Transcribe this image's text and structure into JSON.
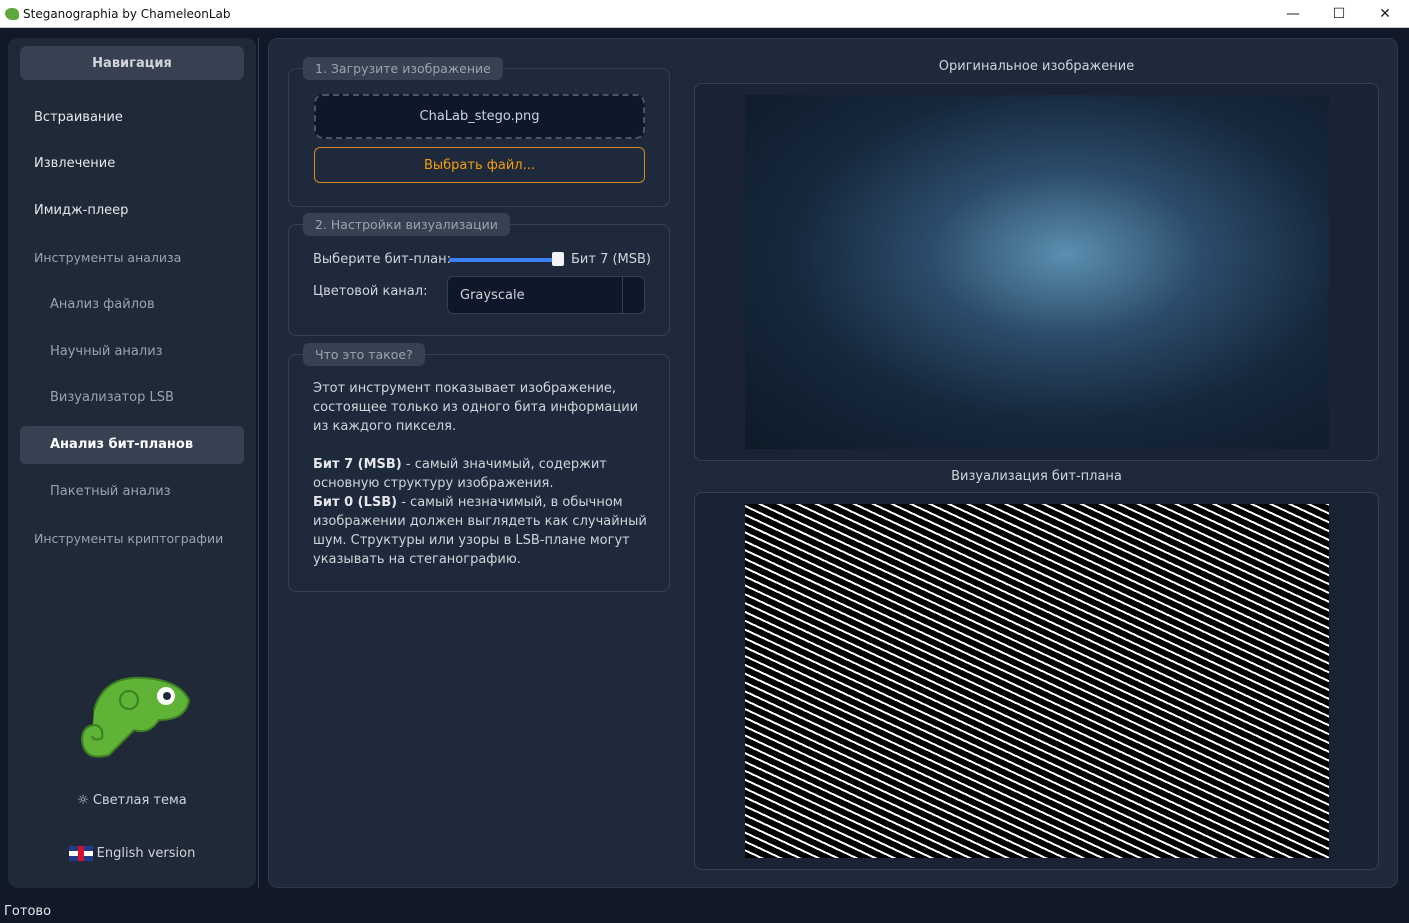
{
  "window": {
    "title": "Steganographia by ChameleonLab",
    "minimize": "—",
    "maximize": "☐",
    "close": "✕"
  },
  "sidebar": {
    "header": "Навигация",
    "items": [
      {
        "label": "Встраивание",
        "type": "top"
      },
      {
        "label": "Извлечение",
        "type": "top"
      },
      {
        "label": "Имидж-плеер",
        "type": "top"
      },
      {
        "label": "Инструменты анализа",
        "type": "cat"
      },
      {
        "label": "Анализ файлов",
        "type": "sub"
      },
      {
        "label": "Научный анализ",
        "type": "sub"
      },
      {
        "label": "Визуализатор LSB",
        "type": "sub"
      },
      {
        "label": "Анализ бит-планов",
        "type": "sub",
        "active": true
      },
      {
        "label": "Пакетный анализ",
        "type": "sub"
      },
      {
        "label": "Инструменты криптографии",
        "type": "cat"
      }
    ],
    "theme_toggle": "Светлая тема",
    "language": "English version"
  },
  "load": {
    "title": "1. Загрузите изображение",
    "filename": "ChaLab_stego.png",
    "choose_button": "Выбрать файл..."
  },
  "settings": {
    "title": "2. Настройки визуализации",
    "bitplane_label": "Выберите бит-план:",
    "bitplane_value": "Бит 7 (MSB)",
    "bitplane_index": 7,
    "bitplane_max": 7,
    "channel_label": "Цветовой канал:",
    "channel_value": "Grayscale"
  },
  "info": {
    "title": "Что это такое?",
    "intro": "Этот инструмент показывает изображение, состоящее только из одного бита информации из каждого пикселя.",
    "msb_term": "Бит 7 (MSB)",
    "msb_text": " - самый значимый, содержит основную структуру изображения.",
    "lsb_term": "Бит 0 (LSB)",
    "lsb_text": " - самый незначимый, в обычном изображении должен выглядеть как случайный шум. Структуры или узоры в LSB-плане могут указывать на стеганографию."
  },
  "preview": {
    "original_title": "Оригинальное изображение",
    "bitplane_title": "Визуализация бит-плана"
  },
  "status": "Готово",
  "colors": {
    "accent": "#3b82f6",
    "button_orange": "#f59e0b",
    "bg": "#111827",
    "panel": "#1e293b"
  }
}
